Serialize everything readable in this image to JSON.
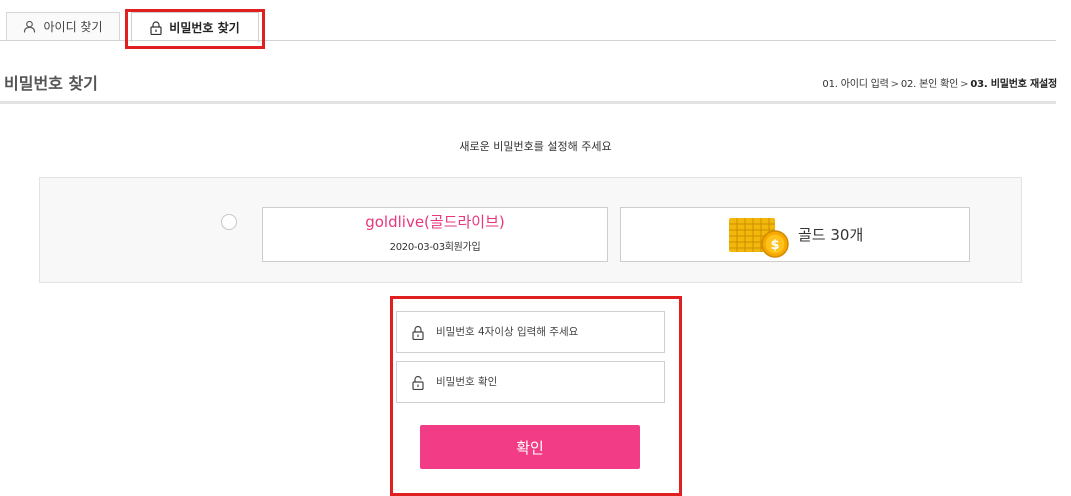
{
  "tabs": {
    "find_id": "아이디 찾기",
    "find_password": "비밀번호 찾기"
  },
  "header": {
    "title": "비밀번호 찾기",
    "breadcrumb": {
      "step1": "01. 아이디 입력",
      "step2": "02. 본인 확인",
      "step3": "03. 비밀번호 재설정",
      "separator": ">"
    }
  },
  "instruction": "새로운 비밀번호를 설정해 주세요",
  "account": {
    "name": "goldlive(골드라이브)",
    "joined": "2020-03-03회원가입",
    "gold": "골드 30개",
    "gold_badge": "$"
  },
  "form": {
    "password_placeholder": "비밀번호 4자이상 입력해 주세요",
    "confirm_placeholder": "비밀번호 확인",
    "submit_label": "확인"
  },
  "colors": {
    "accent": "#f23c86",
    "account_name": "#e8367d",
    "highlight": "#e02020",
    "gold": "#f2b70a"
  }
}
